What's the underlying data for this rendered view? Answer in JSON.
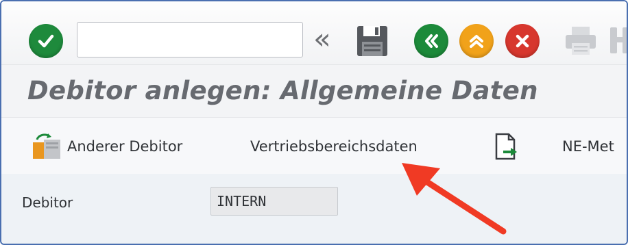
{
  "toolbar": {
    "command_field": {
      "value": "",
      "placeholder": ""
    },
    "icons": [
      "enter-check-icon",
      "double-left-chevron-icon",
      "save-icon",
      "back-icon",
      "exit-icon",
      "cancel-icon",
      "print-icon",
      "find-icon"
    ]
  },
  "title": "Debitor anlegen: Allgemeine Daten",
  "app_toolbar": {
    "anderer_debitor": "Anderer Debitor",
    "vertriebsbereichsdaten": "Vertriebsbereichsdaten",
    "ne_metadata": "NE-Met"
  },
  "form": {
    "debitor_label": "Debitor",
    "debitor_value": "INTERN"
  },
  "colors": {
    "check_green": "#1e8a3c",
    "back_green": "#1c8a3a",
    "exit_yellow": "#f1a21a",
    "cancel_red": "#d7372e",
    "annotation_arrow": "#f03a24",
    "frame_border": "#4a6fb0"
  }
}
